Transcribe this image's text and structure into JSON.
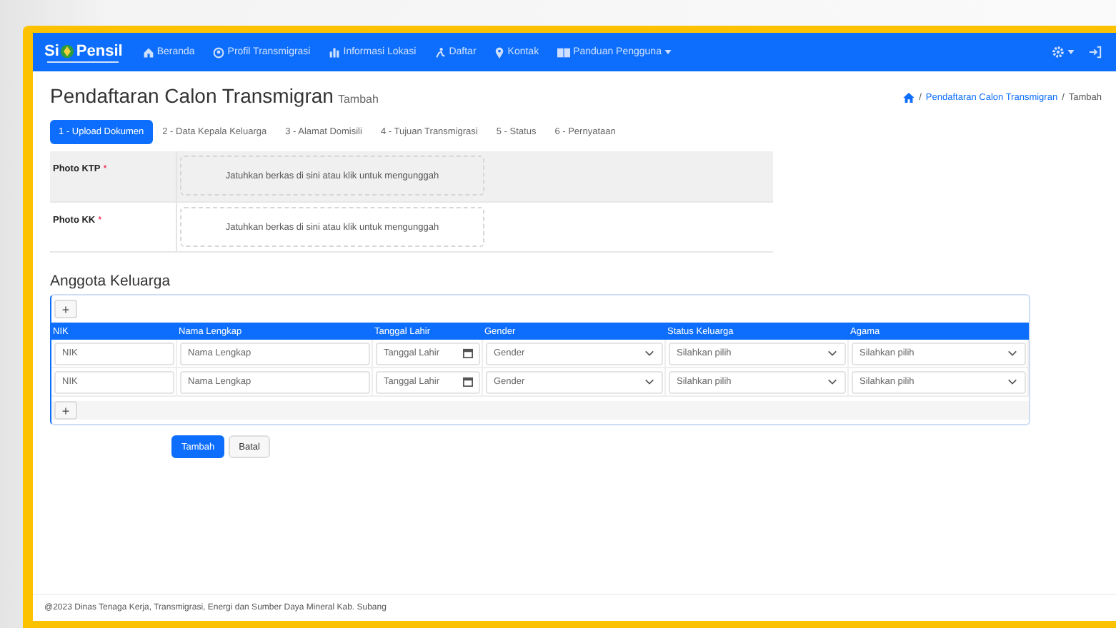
{
  "navbar": {
    "logo": {
      "left": "Si",
      "right": "Pensil"
    },
    "items": [
      {
        "label": "Beranda",
        "dropdown": false
      },
      {
        "label": "Profil Transmigrasi",
        "dropdown": false
      },
      {
        "label": "Informasi Lokasi",
        "dropdown": false
      },
      {
        "label": "Daftar",
        "dropdown": false
      },
      {
        "label": "Kontak",
        "dropdown": false
      },
      {
        "label": "Panduan Pengguna",
        "dropdown": true
      }
    ]
  },
  "header": {
    "title": "Pendaftaran Calon Transmigran",
    "subtitle": "Tambah",
    "breadcrumb_separator": "/",
    "breadcrumb": [
      {
        "label": "Pendaftaran Calon Transmigran",
        "link": true
      },
      {
        "label": "Tambah",
        "link": false
      }
    ]
  },
  "tabs": [
    {
      "label": "1 - Upload Dokumen",
      "selected": true
    },
    {
      "label": "2 - Data Kepala Keluarga",
      "selected": false
    },
    {
      "label": "3 - Alamat Domisili",
      "selected": false
    },
    {
      "label": "4 - Tujuan Transmigrasi",
      "selected": false
    },
    {
      "label": "5 - Status",
      "selected": false
    },
    {
      "label": "6 - Pernyataan",
      "selected": false
    }
  ],
  "uploads": [
    {
      "label": "Photo KTP",
      "required_mark": "*",
      "placeholder": "Jatuhkan berkas di sini atau klik untuk mengunggah",
      "highlighted": true
    },
    {
      "label": "Photo KK",
      "required_mark": "*",
      "placeholder": "Jatuhkan berkas di sini atau klik untuk mengunggah",
      "highlighted": false
    }
  ],
  "family": {
    "title": "Anggota Keluarga",
    "add_button": "+",
    "columns": [
      "NIK",
      "Nama Lengkap",
      "Tanggal Lahir",
      "Gender",
      "Status Keluarga",
      "Agama"
    ],
    "rows": [
      [
        {
          "kind": "text",
          "placeholder": "NIK"
        },
        {
          "kind": "text",
          "placeholder": "Nama Lengkap"
        },
        {
          "kind": "date",
          "placeholder": "Tanggal Lahir"
        },
        {
          "kind": "select",
          "placeholder": "Gender"
        },
        {
          "kind": "select",
          "placeholder": "Silahkan pilih"
        },
        {
          "kind": "select",
          "placeholder": "Silahkan pilih"
        }
      ],
      [
        {
          "kind": "text",
          "placeholder": "NIK"
        },
        {
          "kind": "text",
          "placeholder": "Nama Lengkap"
        },
        {
          "kind": "date",
          "placeholder": "Tanggal Lahir"
        },
        {
          "kind": "select",
          "placeholder": "Gender"
        },
        {
          "kind": "select",
          "placeholder": "Silahkan pilih"
        },
        {
          "kind": "select",
          "placeholder": "Silahkan pilih"
        }
      ]
    ],
    "footer_add_button": "+"
  },
  "actions": [
    {
      "label": "Tambah",
      "kind": "primary"
    },
    {
      "label": "Batal",
      "kind": "secondary"
    }
  ],
  "footer": "@2023 Dinas Tenaga Kerja, Transmigrasi, Energi dan Sumber Daya Mineral Kab. Subang"
}
